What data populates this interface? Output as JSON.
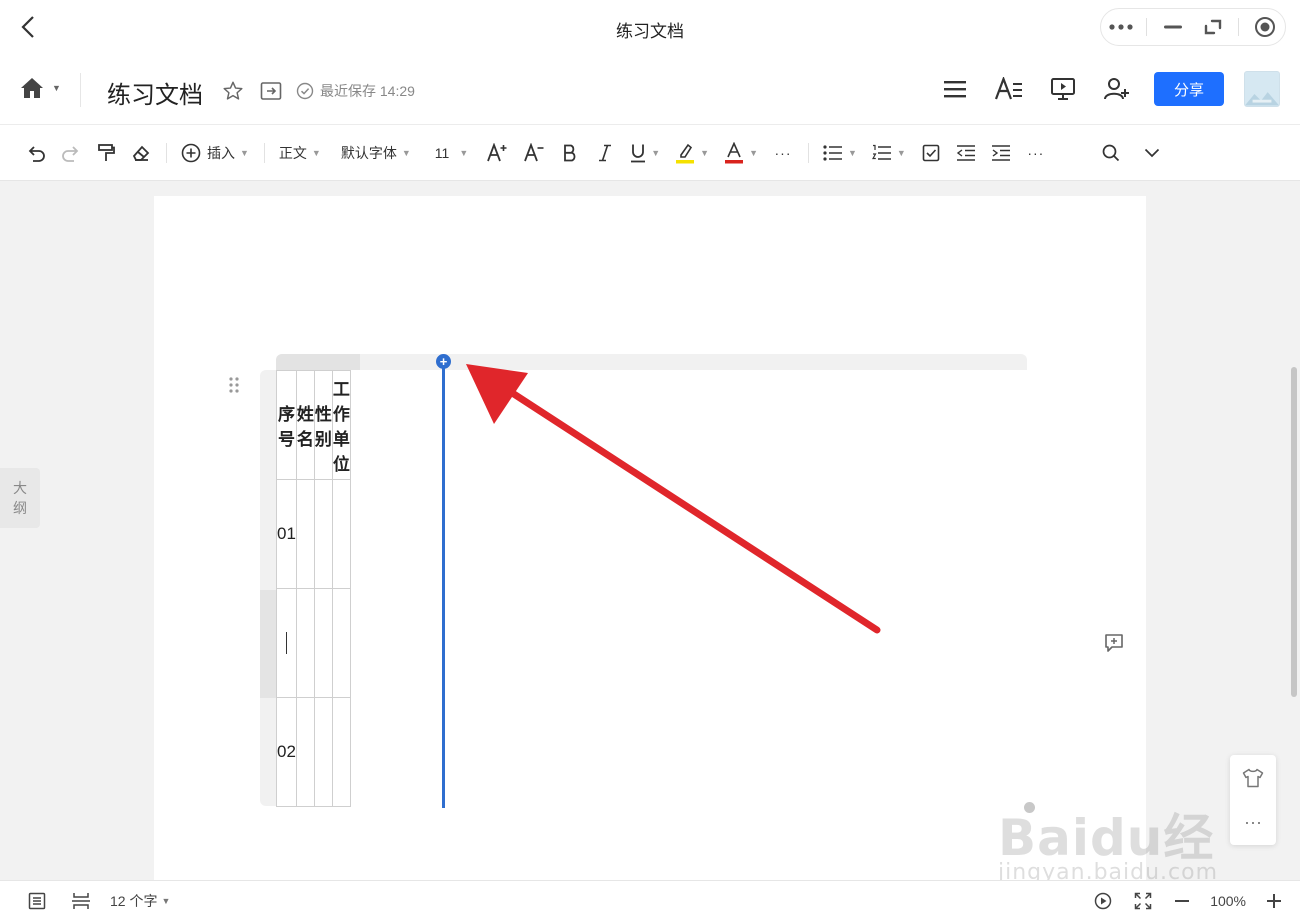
{
  "window": {
    "title": "练习文档"
  },
  "header": {
    "doc_name": "练习文档",
    "save_status": "最近保存 14:29",
    "share_label": "分享"
  },
  "toolbar": {
    "insert_label": "插入",
    "style_label": "正文",
    "font_label": "默认字体",
    "font_size": "11",
    "more_label": "···"
  },
  "outline": {
    "label_line1": "大",
    "label_line2": "纲"
  },
  "table": {
    "headers": [
      "序号",
      "姓名",
      "性别",
      "工作单位"
    ],
    "rows": [
      [
        "01",
        "",
        "",
        ""
      ],
      [
        "",
        "",
        "",
        ""
      ],
      [
        "02",
        "",
        "",
        ""
      ]
    ]
  },
  "statusbar": {
    "word_count": "12 个字",
    "zoom": "100%"
  },
  "watermark": {
    "brand": "Baidu经验",
    "url": "jingyan.baidu.com"
  },
  "colors": {
    "accent": "#1e6fff",
    "insert_line": "#2f6ecf",
    "arrow": "#e0262b",
    "highlight": "#f5e100",
    "font_color": "#d9231d"
  },
  "icons": [
    "back-icon",
    "more-dots-icon",
    "minimize-icon",
    "restore-icon",
    "close-icon",
    "home-icon",
    "star-icon",
    "move-to-folder-icon",
    "check-circle-icon",
    "menu-icon",
    "text-format-icon",
    "present-icon",
    "add-collaborator-icon",
    "undo-icon",
    "redo-icon",
    "format-painter-icon",
    "eraser-icon",
    "plus-circle-icon",
    "increase-font-icon",
    "decrease-font-icon",
    "bold-icon",
    "italic-icon",
    "underline-icon",
    "highlight-icon",
    "font-color-icon",
    "bullet-list-icon",
    "numbered-list-icon",
    "checklist-icon",
    "outdent-icon",
    "indent-icon",
    "search-icon",
    "chevron-down-icon",
    "drag-handle-icon",
    "comment-add-icon",
    "tshirt-icon",
    "outline-list-icon",
    "page-break-icon",
    "play-icon",
    "fullscreen-icon",
    "zoom-out-icon",
    "zoom-in-icon"
  ]
}
